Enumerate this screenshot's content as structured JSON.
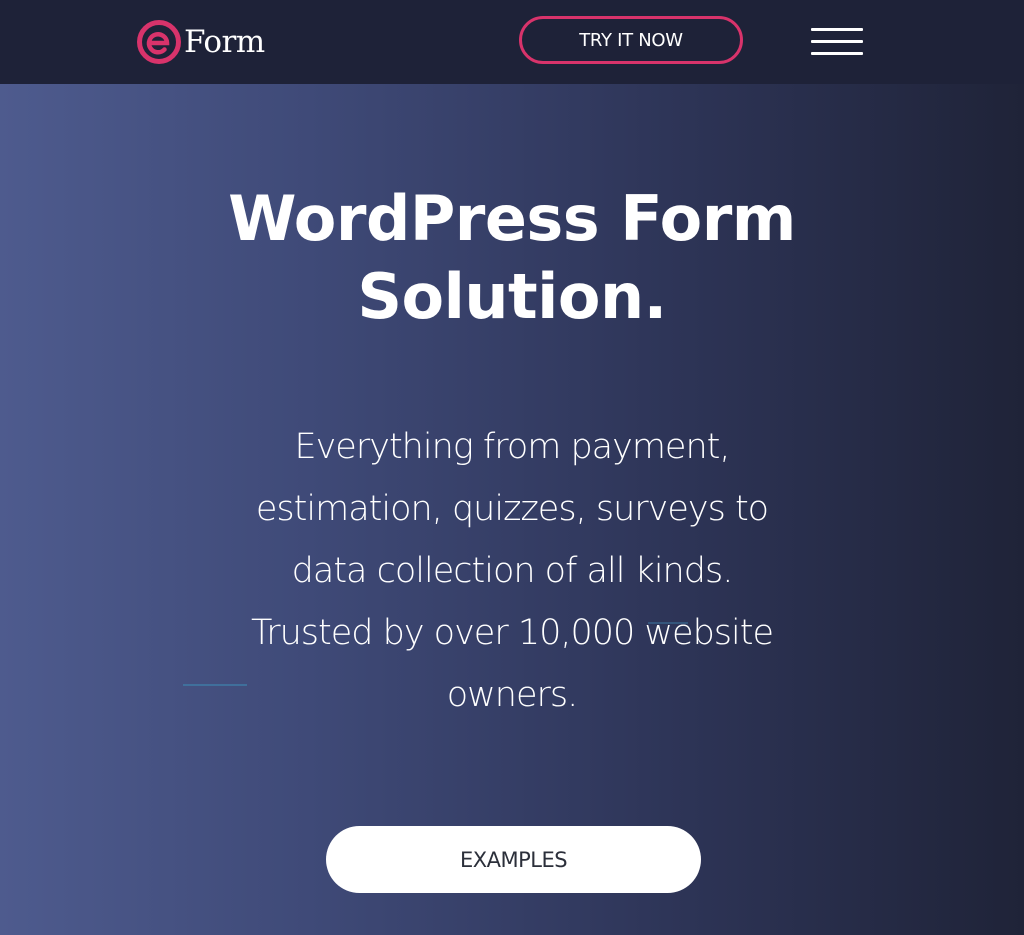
{
  "header": {
    "logo_text": "Form",
    "logo_mark_color": "#d8336b",
    "cta_label": "TRY IT NOW",
    "menu_icon": "hamburger-menu-icon"
  },
  "hero": {
    "title_line1": "WordPress Form",
    "title_line2": "Solution.",
    "description": "Everything from payment, estimation, quizzes, surveys to data collection of all kinds. Trusted by over 10,000 website owners.",
    "button_label": "EXAMPLES"
  },
  "colors": {
    "header_bg": "#1e2238",
    "gradient_left": "#4e5b8e",
    "gradient_right": "#1f2338",
    "accent": "#d8336b",
    "button_bg": "#ffffff"
  }
}
